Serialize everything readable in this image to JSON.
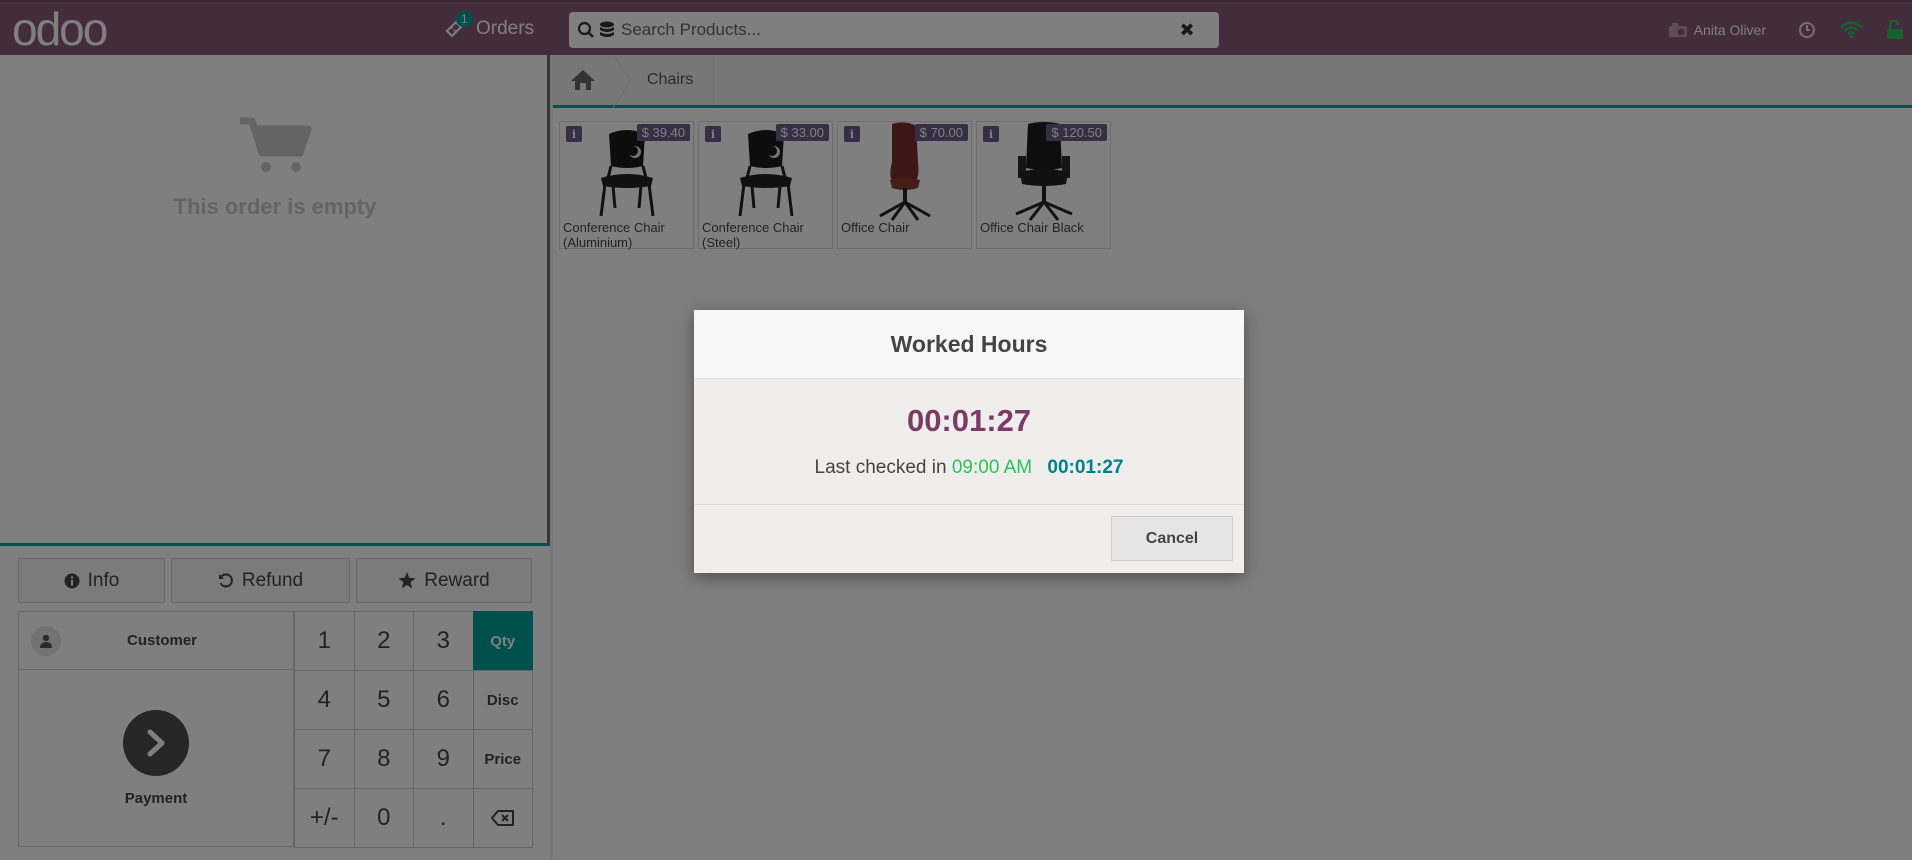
{
  "topbar": {
    "logo": "odoo",
    "orders_label": "Orders",
    "orders_count": "1",
    "search_placeholder": "Search Products...",
    "cashier_name": "Anita Oliver"
  },
  "order": {
    "empty_message": "This order is empty"
  },
  "controls": {
    "info_label": "Info",
    "refund_label": "Refund",
    "reward_label": "Reward",
    "customer_label": "Customer",
    "payment_label": "Payment"
  },
  "numpad": {
    "keys": [
      "1",
      "2",
      "3",
      "Qty",
      "4",
      "5",
      "6",
      "Disc",
      "7",
      "8",
      "9",
      "Price",
      "+/-",
      "0",
      "."
    ],
    "active_mode": "Qty"
  },
  "breadcrumb": {
    "category": "Chairs"
  },
  "products": [
    {
      "name": "Conference Chair (Aluminium)",
      "price": "$ 39.40"
    },
    {
      "name": "Conference Chair (Steel)",
      "price": "$ 33.00"
    },
    {
      "name": "Office Chair",
      "price": "$ 70.00"
    },
    {
      "name": "Office Chair Black",
      "price": "$ 120.50"
    }
  ],
  "dialog": {
    "title": "Worked Hours",
    "elapsed": "00:01:27",
    "checked_in_prefix": "Last checked in",
    "checked_in_time": "09:00 AM",
    "checked_in_duration": "00:01:27",
    "cancel_label": "Cancel"
  },
  "colors": {
    "brand": "#875a7b",
    "accent": "#00a09d",
    "elapsed_time": "#7c3a66",
    "checkin_time": "#28c25a"
  }
}
